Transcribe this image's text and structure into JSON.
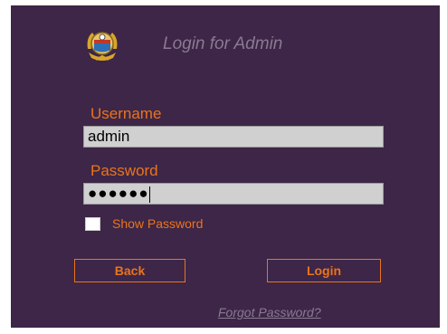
{
  "header": {
    "title": "Login for Admin",
    "logo_icon": "emblem-crest"
  },
  "form": {
    "username_label": "Username",
    "username_value": "admin",
    "password_label": "Password",
    "password_value": "●●●●●●",
    "show_password_label": "Show Password",
    "show_password_checked": false
  },
  "buttons": {
    "back_label": "Back",
    "login_label": "Login"
  },
  "links": {
    "forgot_password": "Forgot Password?"
  },
  "colors": {
    "panel_bg": "#3d2647",
    "accent": "#e9741d",
    "muted_text": "#8a7a92",
    "field_bg": "#d0d0d0"
  }
}
